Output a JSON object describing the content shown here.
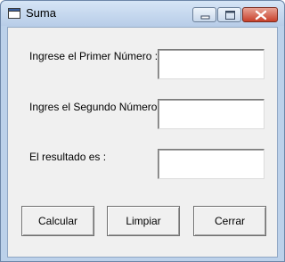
{
  "window": {
    "title": "Suma",
    "controls": {
      "minimize": "minimize-icon",
      "maximize": "maximize-icon",
      "close": "close-icon"
    }
  },
  "form": {
    "label_first": "Ingrese el Primer Número :",
    "label_second": "Ingres el Segundo Número",
    "label_result": "El resultado es :",
    "first_value": "",
    "second_value": "",
    "result_value": ""
  },
  "buttons": {
    "calcular": "Calcular",
    "limpiar": "Limpiar",
    "cerrar": "Cerrar"
  },
  "colors": {
    "title_bar": "#bcd1ea",
    "close_button": "#c8402a",
    "client_background": "#f0f0f0"
  }
}
